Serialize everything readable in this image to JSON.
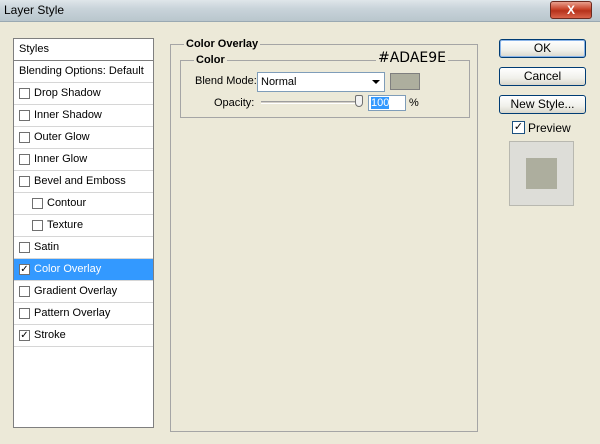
{
  "window": {
    "title": "Layer Style",
    "close_label": "X"
  },
  "left_panel": {
    "header_styles": "Styles",
    "items": [
      {
        "label": "Blending Options: Default",
        "type": "header"
      },
      {
        "label": "Drop Shadow",
        "checked": false
      },
      {
        "label": "Inner Shadow",
        "checked": false
      },
      {
        "label": "Outer Glow",
        "checked": false
      },
      {
        "label": "Inner Glow",
        "checked": false
      },
      {
        "label": "Bevel and Emboss",
        "checked": false
      },
      {
        "label": "Contour",
        "checked": false,
        "indent": true
      },
      {
        "label": "Texture",
        "checked": false,
        "indent": true
      },
      {
        "label": "Satin",
        "checked": false
      },
      {
        "label": "Color Overlay",
        "checked": true,
        "selected": true
      },
      {
        "label": "Gradient Overlay",
        "checked": false
      },
      {
        "label": "Pattern Overlay",
        "checked": false
      },
      {
        "label": "Stroke",
        "checked": true
      }
    ]
  },
  "color_overlay": {
    "section_title": "Color Overlay",
    "sub_title": "Color",
    "hex_annotation": "#ADAE9E",
    "blend_mode_label": "Blend Mode:",
    "blend_mode_value": "Normal",
    "swatch_color": "#adae9e",
    "opacity_label": "Opacity:",
    "opacity_value": "100",
    "opacity_unit": "%"
  },
  "buttons": {
    "ok": "OK",
    "cancel": "Cancel",
    "new_style": "New Style..."
  },
  "preview": {
    "label": "Preview",
    "checked": true,
    "color": "#adae9e"
  },
  "colors": {
    "selection": "#3399ff",
    "panel_bg": "#ece9d8"
  }
}
